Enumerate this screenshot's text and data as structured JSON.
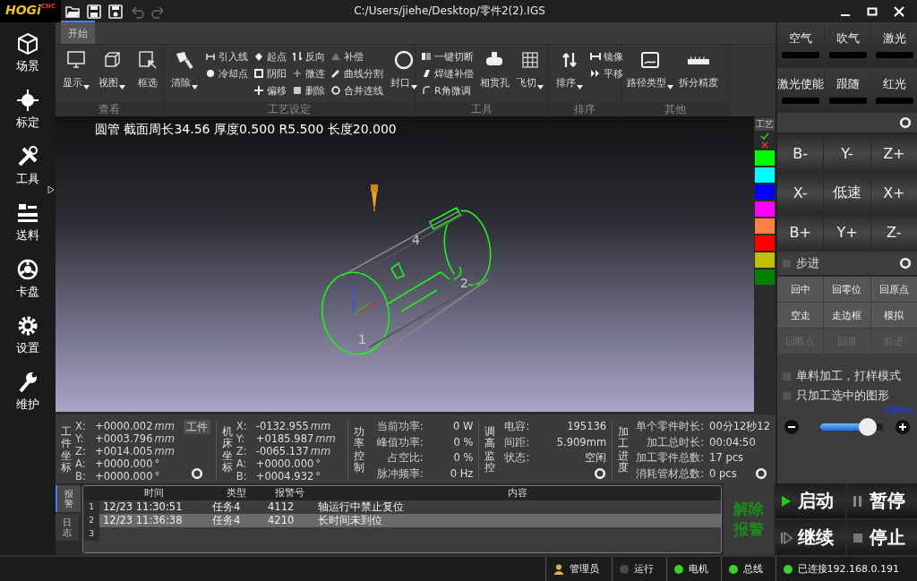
{
  "title_bar": {
    "logo": "HOGi",
    "logo_sub": "CNC",
    "title": "C:/Users/jiehe/Desktop/零件2(2).IGS"
  },
  "sidebar": [
    {
      "label": "场景"
    },
    {
      "label": "标定"
    },
    {
      "label": "工具"
    },
    {
      "label": "送料"
    },
    {
      "label": "卡盘"
    },
    {
      "label": "设置"
    },
    {
      "label": "维护"
    }
  ],
  "ribbon": {
    "tabs": [
      {
        "label": "开始",
        "selected": true
      }
    ],
    "groups": [
      {
        "title": "查看",
        "items": [
          {
            "kind": "large",
            "label": "显示",
            "dropdown": true
          },
          {
            "kind": "large",
            "label": "视图",
            "dropdown": true
          },
          {
            "kind": "large",
            "label": "框选",
            "dropdown": false
          }
        ]
      },
      {
        "title": "工艺设定",
        "items": [
          {
            "kind": "large",
            "label": "清除",
            "dropdown": true
          },
          {
            "kind": "stack",
            "items": [
              "引入线",
              "冷却点"
            ]
          },
          {
            "kind": "stack",
            "items": [
              "起点",
              "阴阳",
              "偏移"
            ]
          },
          {
            "kind": "stack",
            "items": [
              "反向",
              "微连",
              "删除"
            ]
          },
          {
            "kind": "stack",
            "items": [
              "补偿",
              "曲线分割",
              "合并连线"
            ]
          },
          {
            "kind": "large",
            "label": "封口",
            "dropdown": true
          }
        ]
      },
      {
        "title": "工具",
        "items": [
          {
            "kind": "stack",
            "items": [
              "一键切断",
              "焊缝补偿",
              "R角微调"
            ]
          },
          {
            "kind": "large",
            "label": "相贯孔",
            "dropdown": false
          },
          {
            "kind": "large",
            "label": "飞切",
            "dropdown": true
          }
        ]
      },
      {
        "title": "排序",
        "items": [
          {
            "kind": "large",
            "label": "排序",
            "dropdown": true
          },
          {
            "kind": "stack",
            "items": [
              "镜像",
              "平移"
            ]
          }
        ]
      },
      {
        "title": "其他",
        "items": [
          {
            "kind": "large",
            "label": "路径类型",
            "dropdown": true
          },
          {
            "kind": "large",
            "label": "拆分精度",
            "dropdown": false
          }
        ]
      }
    ]
  },
  "viewport": {
    "info": "圆管 截面周长34.56 厚度0.500 R5.500 长度20.000",
    "point_labels": [
      "1",
      "2",
      "4"
    ]
  },
  "layer_column": {
    "title": "工艺",
    "colors": [
      {
        "color": "#00ff00"
      },
      {
        "color": "#00ffff"
      },
      {
        "color": "#0000ff"
      },
      {
        "color": "#ff00ff"
      },
      {
        "color": "#ff8040"
      },
      {
        "color": "#ff0000"
      },
      {
        "color": "#c0c000"
      },
      {
        "color": "#008000"
      }
    ]
  },
  "right_panel": {
    "io": [
      {
        "label": "空气",
        "on": false
      },
      {
        "label": "吹气",
        "on": false
      },
      {
        "label": "激光",
        "on": false
      },
      {
        "label": "激光使能",
        "on": false
      },
      {
        "label": "跟随",
        "on": false
      },
      {
        "label": "红光",
        "on": false
      }
    ],
    "jog": [
      "B-",
      "Y-",
      "Z+",
      "X-",
      "低速",
      "X+",
      "B+",
      "Y+",
      "Z-"
    ],
    "step": {
      "label": "步进",
      "checked": false
    },
    "functions": [
      {
        "label": "回中",
        "disabled": false
      },
      {
        "label": "回零位",
        "disabled": false
      },
      {
        "label": "回原点",
        "disabled": false
      },
      {
        "label": "空走",
        "disabled": false
      },
      {
        "label": "走边框",
        "disabled": false
      },
      {
        "label": "模拟",
        "disabled": false
      },
      {
        "label": "回断点",
        "disabled": true
      },
      {
        "label": "回退",
        "disabled": true
      },
      {
        "label": "前进",
        "disabled": true
      }
    ],
    "options": [
      {
        "label": "单料加工，打样模式",
        "checked": false
      },
      {
        "label": "只加工选中的图形",
        "checked": false
      }
    ],
    "speed": {
      "reading": "100%",
      "level": 0.85
    }
  },
  "info_panel": {
    "work_coords": {
      "title": "工件坐标",
      "button": "工件",
      "rows": [
        {
          "axis": "X:",
          "value": "+0000.002",
          "unit": "mm"
        },
        {
          "axis": "Y:",
          "value": "+0003.796",
          "unit": "mm"
        },
        {
          "axis": "Z:",
          "value": "+0014.005",
          "unit": "mm"
        },
        {
          "axis": "A:",
          "value": "+0000.000",
          "unit": "°"
        },
        {
          "axis": "B:",
          "value": "+0000.000",
          "unit": "°"
        }
      ]
    },
    "machine_coords": {
      "title": "机床坐标",
      "rows": [
        {
          "axis": "X:",
          "value": "-0132.955",
          "unit": "mm"
        },
        {
          "axis": "Y:",
          "value": "+0185.987",
          "unit": "mm"
        },
        {
          "axis": "Z:",
          "value": "-0065.137",
          "unit": "mm"
        },
        {
          "axis": "A:",
          "value": "+0000.000",
          "unit": "°"
        },
        {
          "axis": "B:",
          "value": "+0004.932",
          "unit": "°"
        }
      ]
    },
    "power": {
      "title": "功率控制",
      "rows": [
        {
          "label": "当前功率:",
          "value": "0 W"
        },
        {
          "label": "峰值功率:",
          "value": "0 %"
        },
        {
          "label": "占空比:",
          "value": "0 %"
        },
        {
          "label": "脉冲频率:",
          "value": "0 Hz"
        }
      ]
    },
    "height": {
      "title": "调高监控",
      "rows": [
        {
          "label": "电容:",
          "value": "195136"
        },
        {
          "label": "间距:",
          "value": "5.909mm"
        },
        {
          "label": "状态:",
          "value": "空闲"
        }
      ]
    },
    "progress": {
      "title": "加工进度",
      "rows": [
        {
          "label": "单个零件时长:",
          "value": "00分12秒12"
        },
        {
          "label": "加工总时长:",
          "value": "00:04:50"
        },
        {
          "label": "加工零件总数:",
          "value": "17 pcs"
        },
        {
          "label": "消耗管材总数:",
          "value": "0 pcs"
        }
      ]
    }
  },
  "log": {
    "tabs": [
      {
        "label": "报警",
        "selected": true
      },
      {
        "label": "日志",
        "selected": false
      }
    ],
    "columns": [
      "时间",
      "类型",
      "报警号",
      "内容"
    ],
    "rows": [
      {
        "index": "1",
        "time": "12/23 11:30:51",
        "type": "任务4",
        "code": "4112",
        "content": "轴运行中禁止复位",
        "selected": false
      },
      {
        "index": "2",
        "time": "12/23 11:36:38",
        "type": "任务4",
        "code": "4210",
        "content": "长时间未到位",
        "selected": true
      },
      {
        "index": "3",
        "selected": false
      }
    ]
  },
  "run_controls": {
    "clear_alarm": "解除报警",
    "buttons": [
      {
        "kind": "start",
        "label": "启动"
      },
      {
        "kind": "pause",
        "label": "暂停"
      },
      {
        "kind": "resume",
        "label": "继续"
      },
      {
        "kind": "stop",
        "label": "停止"
      }
    ]
  },
  "status_bar": [
    {
      "kind": "user",
      "label": "管理员"
    },
    {
      "kind": "dot",
      "label": "运行",
      "color": "#4a4a4a"
    },
    {
      "kind": "dot",
      "label": "电机",
      "color": "#44cc33"
    },
    {
      "kind": "dot",
      "label": "总线",
      "color": "#44cc33"
    },
    {
      "kind": "dot",
      "label": "已连接192.168.0.191",
      "color": "#44cc33"
    }
  ]
}
